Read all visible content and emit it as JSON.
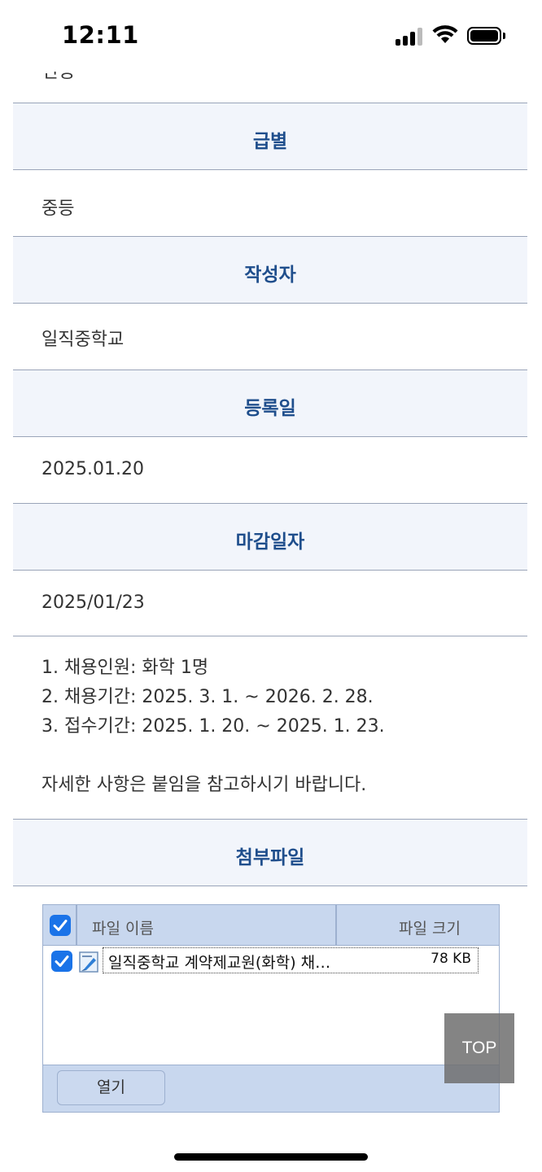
{
  "status_bar": {
    "time": "12:11"
  },
  "partial_row_text": "안동",
  "rows": [
    {
      "label": "급별",
      "value": "중등"
    },
    {
      "label": "작성자",
      "value": "일직중학교"
    },
    {
      "label": "등록일",
      "value": "2025.01.20"
    },
    {
      "label": "마감일자",
      "value": "2025/01/23"
    }
  ],
  "content": {
    "lines": [
      "1. 채용인원: 화학 1명",
      "2. 채용기간: 2025. 3. 1. ~ 2026. 2. 28.",
      "3. 접수기간: 2025. 1. 20. ~ 2025. 1. 23."
    ],
    "note": "자세한 사항은 붙임을 참고하시기 바랍니다."
  },
  "attachments": {
    "section_label": "첨부파일",
    "col_name": "파일 이름",
    "col_size": "파일 크기",
    "files": [
      {
        "name": "일직중학교 계약제교원(화학) 채…",
        "size": "78 KB",
        "checked": true
      }
    ],
    "open_button": "열기"
  },
  "top_button": "TOP",
  "colors": {
    "header_text": "#1f4e8c",
    "header_bg": "#f2f5fb",
    "widget_bg": "#c8d7ee",
    "checkbox": "#1a73e8"
  }
}
